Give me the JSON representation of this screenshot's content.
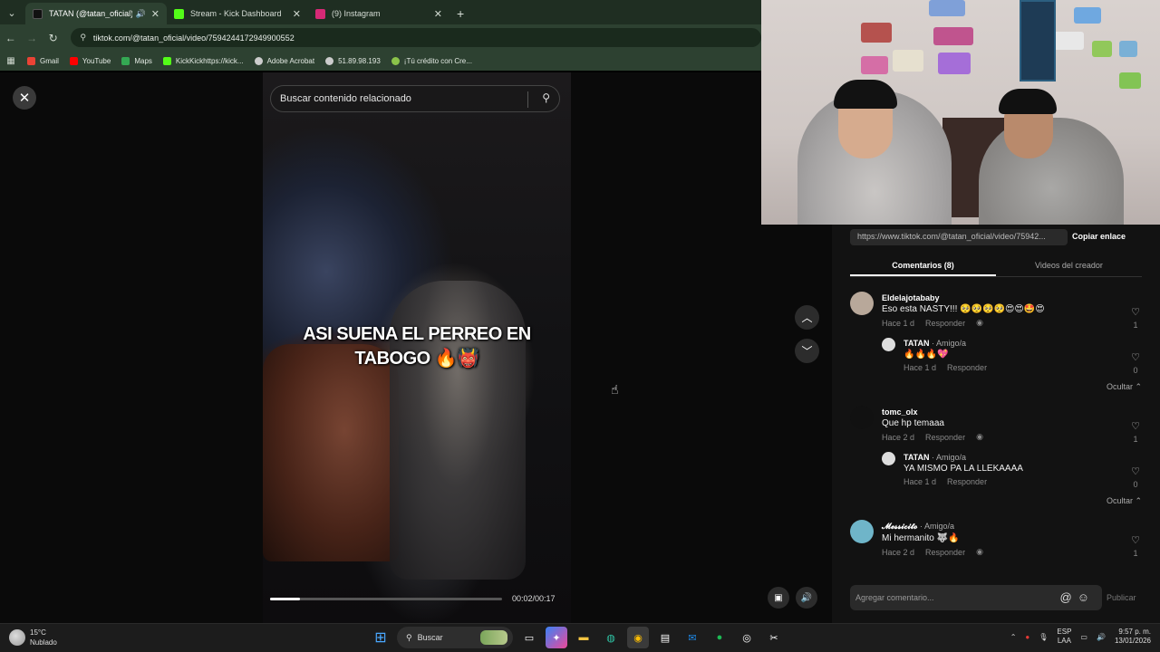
{
  "browser": {
    "tabs": [
      {
        "title": "TATAN (@tatan_oficial) | Ti",
        "active": true,
        "favicon_color": "#111111"
      },
      {
        "title": "Stream - Kick Dashboard",
        "active": false,
        "favicon_color": "#53fc18"
      },
      {
        "title": "(9) Instagram",
        "active": false,
        "favicon_color": "#d62976"
      }
    ],
    "new_tab": "+",
    "url": "tiktok.com/@tatan_oficial/video/7594244172949900552",
    "bookmarks": [
      {
        "label": "Gmail",
        "color": "#ea4335"
      },
      {
        "label": "YouTube",
        "color": "#ff0000"
      },
      {
        "label": "Maps",
        "color": "#34a853"
      },
      {
        "label": "KickKickhttps://kick...",
        "color": "#53fc18"
      },
      {
        "label": "Adobe Acrobat",
        "color": "#cccccc"
      },
      {
        "label": "51.89.98.193",
        "color": "#cccccc"
      },
      {
        "label": "¡Tú crédito con Cre...",
        "color": "#8bc34a"
      }
    ]
  },
  "viewer": {
    "close": "✕",
    "search_placeholder": "Buscar contenido relacionado",
    "caption_line1": "ASI SUENA EL PERREO EN",
    "caption_line2": "TABOGO 🔥👹",
    "time": "00:02/00:17",
    "progress": 0.13
  },
  "panel": {
    "link": "https://www.tiktok.com/@tatan_oficial/video/75942...",
    "copy_link": "Copiar enlace",
    "tab_comments": "Comentarios (8)",
    "tab_videos": "Videos del creador",
    "reply_label": "Responder",
    "hide_label": "Ocultar ⌃",
    "comments": [
      {
        "user": "Eldelajotababy",
        "tag": "",
        "text": "Eso esta NASTY!!! 🥺🥺🥺🥺😍😍🤩😍",
        "time": "Hace 1 d",
        "likes": "1",
        "avatar": "#b8a89a"
      },
      {
        "user": "TATAN",
        "tag": " · Amigo/a",
        "text": "🔥🔥🔥💖",
        "time": "Hace 1 d",
        "likes": "0",
        "avatar": "#dddddd",
        "reply": true
      },
      {
        "user": "tomc_olx",
        "tag": "",
        "text": "Que hp temaaa",
        "time": "Hace 2 d",
        "likes": "1",
        "avatar": "#111111"
      },
      {
        "user": "TATAN",
        "tag": " · Amigo/a",
        "text": "YA MISMO PA LA LLEKAAAA",
        "time": "Hace 1 d",
        "likes": "0",
        "avatar": "#dddddd",
        "reply": true
      },
      {
        "user": "𝓜𝓮𝓼𝓼𝓲𝓬𝓲𝓽𝓸",
        "tag": " · Amigo/a",
        "text": "Mi hermanito 🐺🔥",
        "time": "Hace 2 d",
        "likes": "1",
        "avatar": "#6fb5c9"
      }
    ],
    "add_comment_placeholder": "Agregar comentario...",
    "publish": "Publicar"
  },
  "taskbar": {
    "temp": "15°C",
    "weather": "Nublado",
    "search": "Buscar",
    "lang1": "ESP",
    "lang2": "LAA",
    "time": "9:57 p. m.",
    "date": "13/01/2026"
  }
}
